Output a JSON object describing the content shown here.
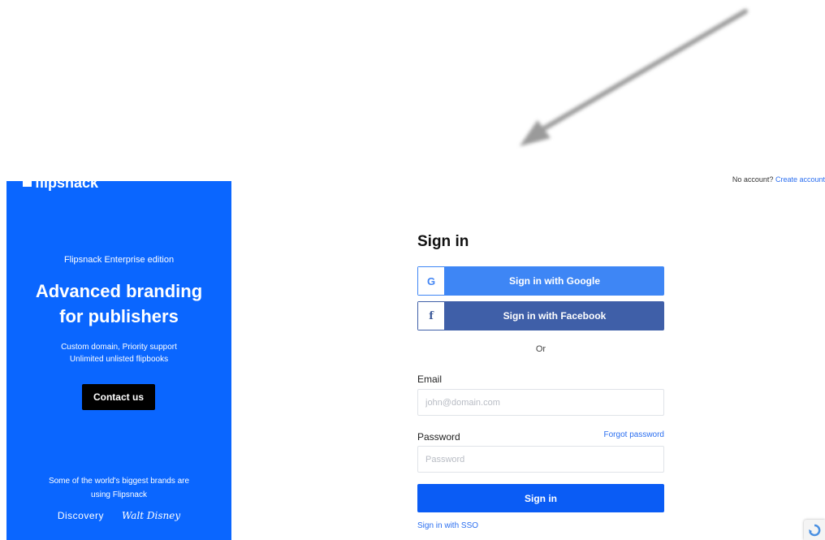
{
  "promo": {
    "logo_text": "flipsnack",
    "edition": "Flipsnack Enterprise edition",
    "headline_line1": "Advanced branding",
    "headline_line2": "for publishers",
    "features_line1": "Custom domain, Priority support",
    "features_line2": "Unlimited unlisted flipbooks",
    "contact_label": "Contact us",
    "brands_line1": "Some of the world's biggest brands are",
    "brands_line2": "using Flipsnack",
    "brand_1": "Discovery",
    "brand_2": "Walt Disney",
    "brand_row2": [
      "",
      "",
      ""
    ],
    "color": "#0a66ff"
  },
  "header": {
    "no_account_text": "No account?",
    "create_account_link": "Create account"
  },
  "form": {
    "title": "Sign in",
    "google_icon": "G",
    "google_label": "Sign in with Google",
    "facebook_icon": "f",
    "facebook_label": "Sign in with Facebook",
    "or_text": "Or",
    "email_label": "Email",
    "email_placeholder": "john@domain.com",
    "email_value": "",
    "password_label": "Password",
    "password_placeholder": "Password",
    "password_value": "",
    "forgot_label": "Forgot password",
    "submit_label": "Sign in",
    "sso_label": "Sign in with SSO",
    "accent_color": "#0a5cf5",
    "google_color": "#3e86f5",
    "facebook_color": "#3f5fa8"
  },
  "icons": {
    "pointer_arrow": "arrow-down-left-icon",
    "recaptcha": "recaptcha-icon"
  }
}
